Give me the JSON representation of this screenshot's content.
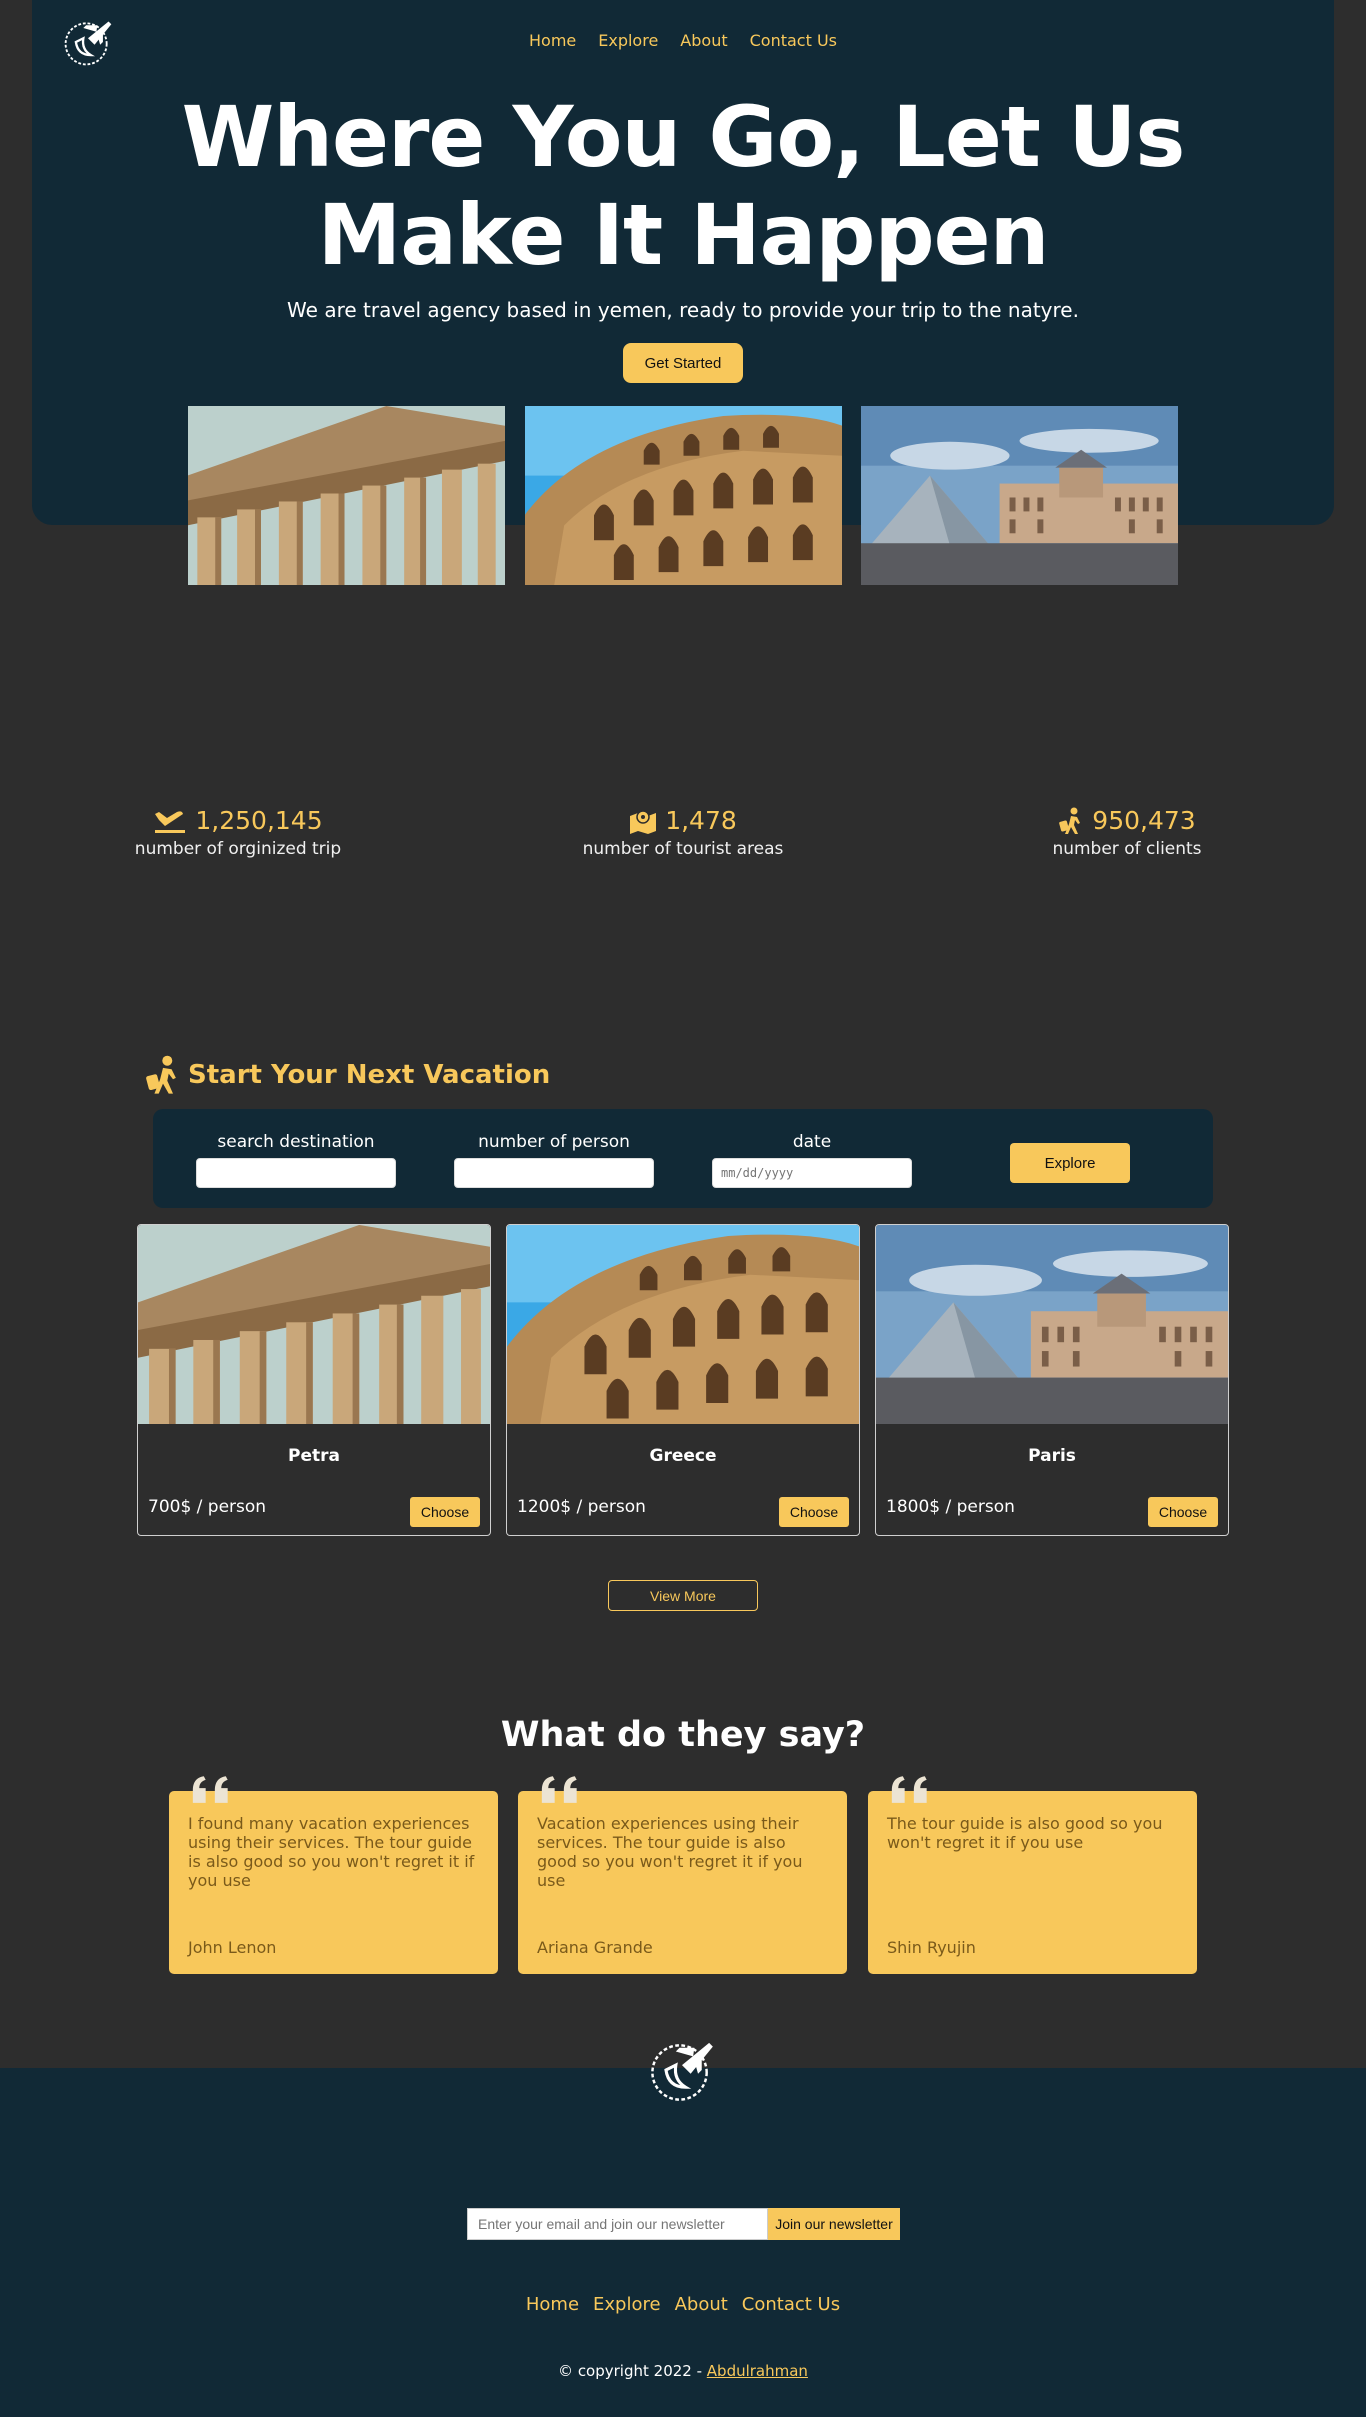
{
  "nav": {
    "items": [
      "Home",
      "Explore",
      "About",
      "Contact Us"
    ]
  },
  "hero": {
    "title_line1": "Where You Go, Let Us",
    "title_line2": "Make It Happen",
    "subtitle": "We are travel agency based in yemen, ready to provide your trip to the natyre.",
    "cta_label": "Get Started"
  },
  "stats": [
    {
      "icon": "plane-landing-icon",
      "value": "1,250,145",
      "label": "number of orginized trip"
    },
    {
      "icon": "map-location-icon",
      "value": "1,478",
      "label": "number of tourist areas"
    },
    {
      "icon": "traveler-icon",
      "value": "950,473",
      "label": "number of clients"
    }
  ],
  "vacation": {
    "title": "Start Your Next Vacation",
    "fields": {
      "destination_label": "search destination",
      "persons_label": "number of person",
      "date_label": "date",
      "date_placeholder": "mm/dd/yyyy"
    },
    "explore_label": "Explore"
  },
  "cards": [
    {
      "name": "Petra",
      "price": "700$ / person",
      "button": "Choose"
    },
    {
      "name": "Greece",
      "price": "1200$ / person",
      "button": "Choose"
    },
    {
      "name": "Paris",
      "price": "1800$ / person",
      "button": "Choose"
    }
  ],
  "view_more_label": "View More",
  "testimonials": {
    "title": "What do they say?",
    "items": [
      {
        "text": "I found many vacation experiences using their services. The tour guide is also good so you won't regret it if you use",
        "author": "John Lenon"
      },
      {
        "text": "Vacation experiences using their services. The tour guide is also good so you won't regret it if you use",
        "author": "Ariana Grande"
      },
      {
        "text": "The tour guide is also good so you won't regret it if you use",
        "author": "Shin Ryujin"
      }
    ]
  },
  "footer": {
    "newsletter_placeholder": "Enter your email and join our newsletter",
    "newsletter_button": "Join our newsletter",
    "nav": [
      "Home",
      "Explore",
      "About",
      "Contact Us"
    ],
    "copyright_prefix": "© copyright 2022 - ",
    "copyright_author": "Abdulrahman"
  },
  "colors": {
    "accent": "#f8c85b",
    "navy": "#112936",
    "background": "#2d2d2d"
  }
}
